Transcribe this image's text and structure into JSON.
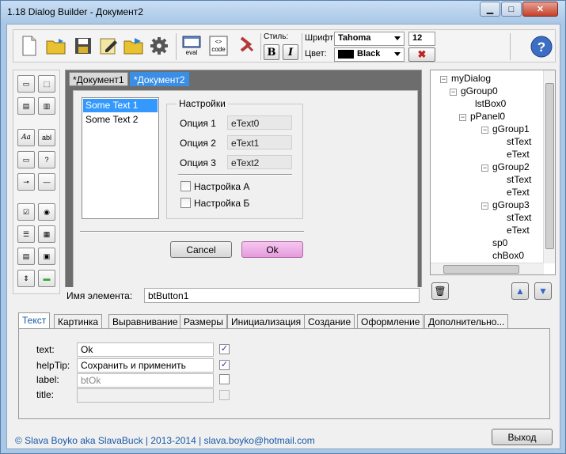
{
  "window": {
    "title": "1.18 Dialog Builder - Документ2"
  },
  "toolbar": {
    "style_label": "Стиль:",
    "bold": "B",
    "italic": "I",
    "font_label": "Шрифт",
    "font_value": "Tahoma",
    "size_value": "12",
    "color_label": "Цвет:",
    "color_value": "Black",
    "color_hex": "#000000",
    "eval_label": "eval",
    "code_label": "code",
    "help": "?"
  },
  "doc_tabs": [
    "*Документ1",
    "*Документ2"
  ],
  "canvas": {
    "list_items": [
      "Some Text 1",
      "Some Text 2"
    ],
    "group_title": "Настройки",
    "options": [
      {
        "label": "Опция 1",
        "value": "eText0"
      },
      {
        "label": "Опция 2",
        "value": "eText1"
      },
      {
        "label": "Опция 3",
        "value": "eText2"
      }
    ],
    "checkboxes": [
      "Настройка А",
      "Настройка Б"
    ],
    "cancel": "Cancel",
    "ok": "Ok"
  },
  "element_name": {
    "label": "Имя элемента:",
    "value": "btButton1"
  },
  "tree": {
    "root": "myDialog",
    "nodes": [
      "gGroup0",
      "lstBox0",
      "pPanel0",
      "gGroup1",
      "stText",
      "eText",
      "gGroup2",
      "stText",
      "eText",
      "gGroup3",
      "stText",
      "eText",
      "sp0",
      "chBox0"
    ]
  },
  "prop_tabs": [
    "Текст",
    "Картинка",
    "Выравнивание",
    "Размеры",
    "Инициализация",
    "Создание",
    "Оформление",
    "Дополнительно..."
  ],
  "props": [
    {
      "label": "text:",
      "value": "Ok",
      "checked": true
    },
    {
      "label": "helpTip:",
      "value": "Сохранить и применить",
      "checked": true
    },
    {
      "label": "label:",
      "value": "btOk",
      "checked": false
    },
    {
      "label": "title:",
      "value": "",
      "checked": false
    }
  ],
  "footer": {
    "text": "© Slava Boyko aka SlavaBuck | 2013-2014 | slava.boyko@hotmail.com",
    "exit": "Выход"
  }
}
